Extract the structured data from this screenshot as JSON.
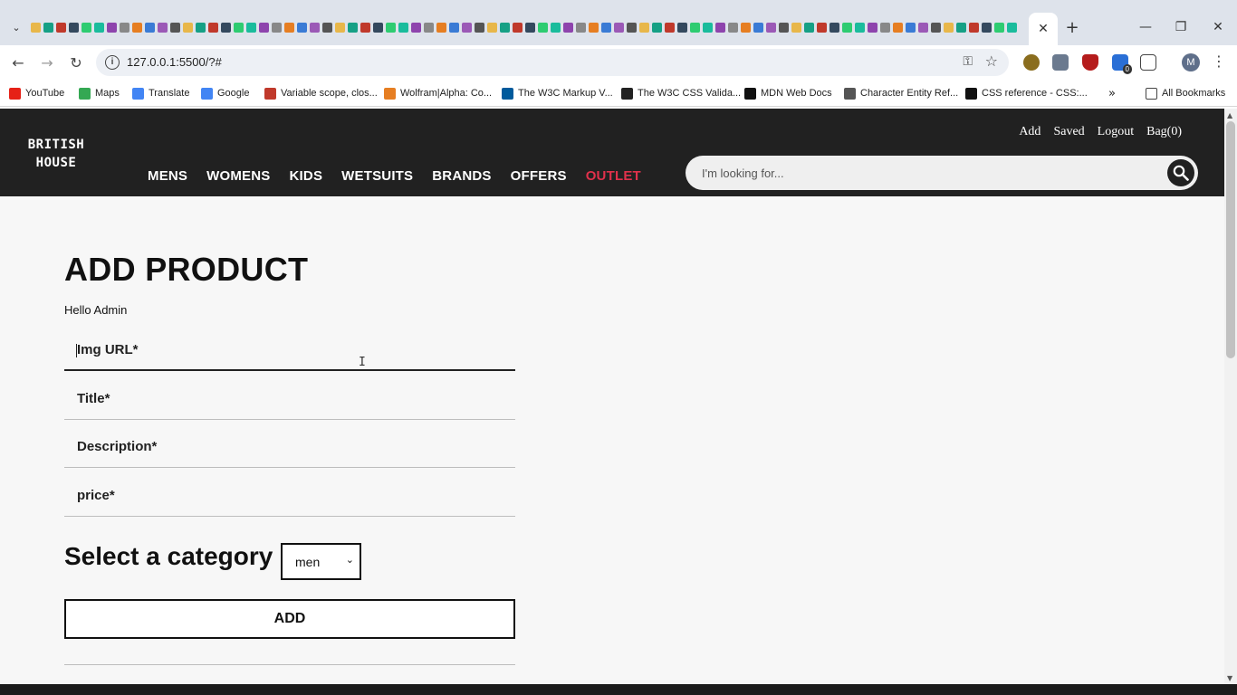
{
  "browser": {
    "url": "127.0.0.1:5500/?#",
    "profile_initial": "M",
    "extension_badge": "0",
    "bookmarks": [
      {
        "label": "YouTube",
        "color": "#e62117"
      },
      {
        "label": "Maps",
        "color": "#34a853"
      },
      {
        "label": "Translate",
        "color": "#4285f4"
      },
      {
        "label": "Google",
        "color": "#4285f4"
      },
      {
        "label": "Variable scope, clos...",
        "color": "#c0392b"
      },
      {
        "label": "Wolfram|Alpha: Co...",
        "color": "#e67e22"
      },
      {
        "label": "The W3C Markup V...",
        "color": "#005a9c"
      },
      {
        "label": "The W3C CSS Valida...",
        "color": "#222222"
      },
      {
        "label": "MDN Web Docs",
        "color": "#111111"
      },
      {
        "label": "Character Entity Ref...",
        "color": "#555555"
      },
      {
        "label": "CSS reference - CSS:...",
        "color": "#111111"
      }
    ],
    "all_bookmarks_label": "All Bookmarks"
  },
  "site": {
    "logo_line1": "BRITISH",
    "logo_line2": "HOUSE",
    "nav": [
      "MENS",
      "WOMENS",
      "KIDS",
      "WETSUITS",
      "BRANDS",
      "OFFERS",
      "OUTLET"
    ],
    "user_links": [
      "Add",
      "Saved",
      "Logout",
      "Bag(0)"
    ],
    "search_placeholder": "I'm looking for...",
    "accent_color": "#e0314b"
  },
  "form": {
    "title": "ADD PRODUCT",
    "greeting": "Hello Admin",
    "fields": [
      {
        "placeholder": "Img URL*",
        "value": ""
      },
      {
        "placeholder": "Title*",
        "value": ""
      },
      {
        "placeholder": "Description*",
        "value": ""
      },
      {
        "placeholder": "price*",
        "value": ""
      }
    ],
    "category_label": "Select a category",
    "category_selected": "men",
    "submit_label": "ADD"
  }
}
